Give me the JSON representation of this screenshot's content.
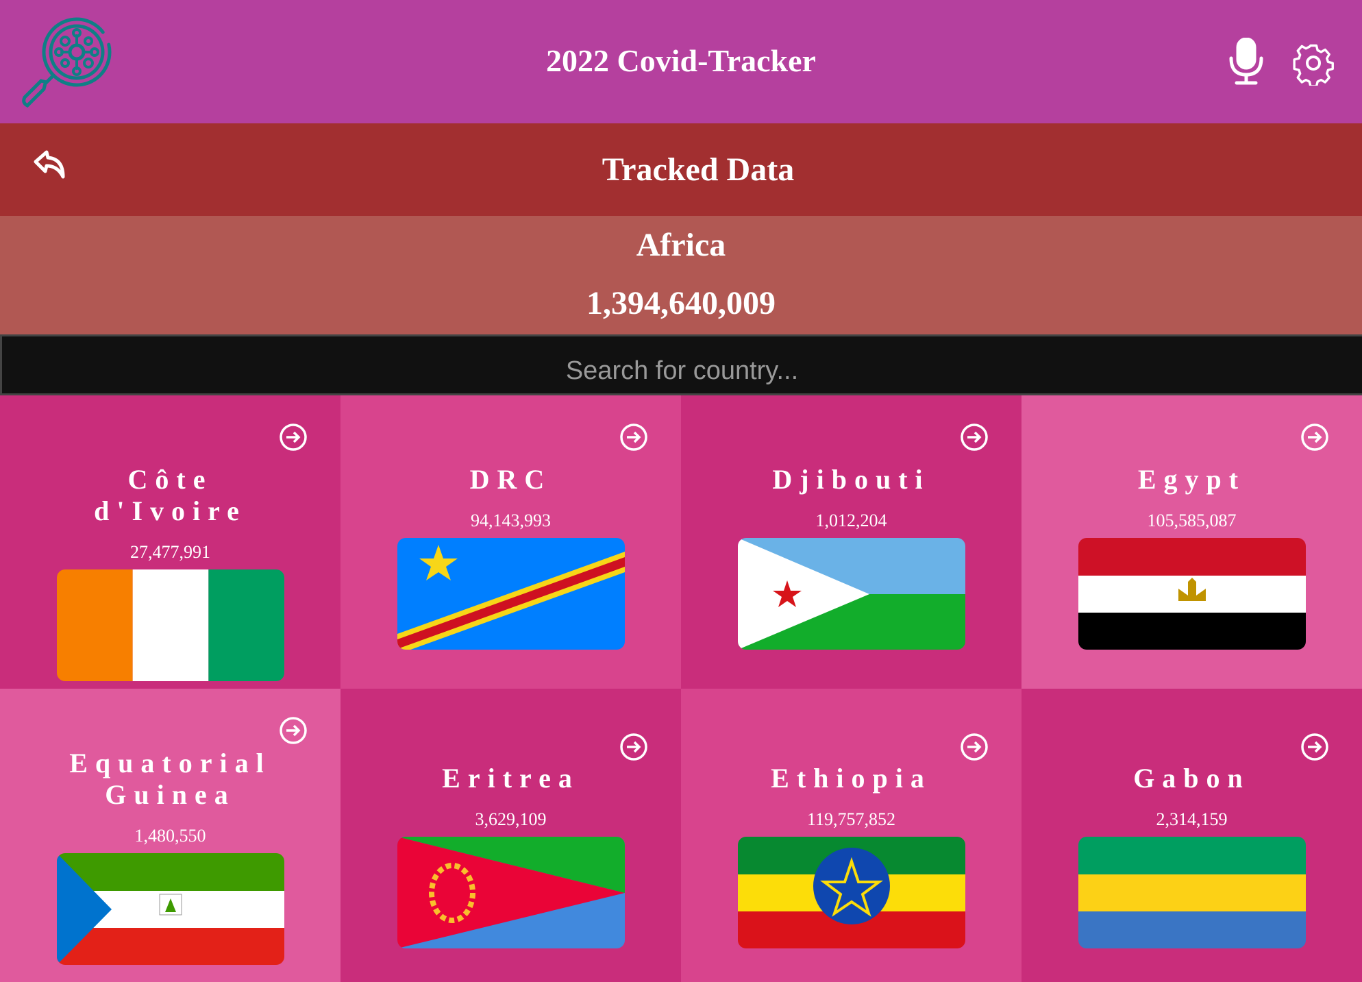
{
  "header": {
    "title": "2022 Covid-Tracker",
    "icons": [
      "virus-search-logo",
      "microphone-icon",
      "gear-icon"
    ]
  },
  "subheader": {
    "title": "Tracked Data",
    "back_icon": "back-arrow-icon"
  },
  "region": {
    "name": "Africa",
    "total": "1,394,640,009"
  },
  "search": {
    "placeholder": "Search for country...",
    "value": ""
  },
  "countries": [
    {
      "name": "Côte d'Ivoire",
      "count": "27,477,991"
    },
    {
      "name": "DRC",
      "count": "94,143,993"
    },
    {
      "name": "Djibouti",
      "count": "1,012,204"
    },
    {
      "name": "Egypt",
      "count": "105,585,087"
    },
    {
      "name": "Equatorial Guinea",
      "count": "1,480,550"
    },
    {
      "name": "Eritrea",
      "count": "3,629,109"
    },
    {
      "name": "Ethiopia",
      "count": "119,757,852"
    },
    {
      "name": "Gabon",
      "count": "2,314,159"
    }
  ],
  "colors": {
    "header": "#b5409e",
    "subheader": "#a22f30",
    "region": "#b15853",
    "logo": "#0f7f86"
  }
}
